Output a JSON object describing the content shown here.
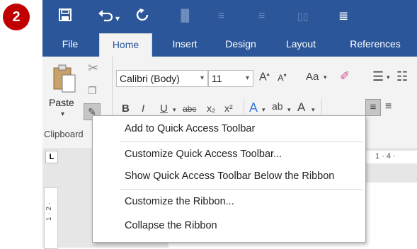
{
  "step_badge": "2",
  "qat": {
    "save_icon": "save-icon",
    "undo_icon": "undo-icon",
    "undo_dropdown": "▾",
    "redo_icon": "redo-icon"
  },
  "tabs": [
    {
      "label": "File"
    },
    {
      "label": "Home"
    },
    {
      "label": "Insert"
    },
    {
      "label": "Design"
    },
    {
      "label": "Layout"
    },
    {
      "label": "References"
    }
  ],
  "ribbon": {
    "paste_label": "Paste",
    "clipboard_group": "Clipboard",
    "font_name": "Calibri (Body)",
    "font_size": "11",
    "change_case": "Aa",
    "bold": "B",
    "italic": "I",
    "underline": "U",
    "strikethrough": "abc",
    "subscript": "x₂",
    "superscript": "x²"
  },
  "ruler": {
    "h_marks": "1 · 4 ·",
    "v_marks": "1 · 2 ·",
    "corner": "L"
  },
  "context_menu": {
    "items": [
      {
        "label": "Add to Quick Access Toolbar"
      },
      {
        "label": "Customize Quick Access Toolbar..."
      },
      {
        "label": "Show Quick Access Toolbar Below the Ribbon"
      },
      {
        "label": "Customize the Ribbon..."
      },
      {
        "label": "Collapse the Ribbon"
      }
    ]
  },
  "colors": {
    "brand": "#2b579a",
    "badge": "#c00000"
  }
}
